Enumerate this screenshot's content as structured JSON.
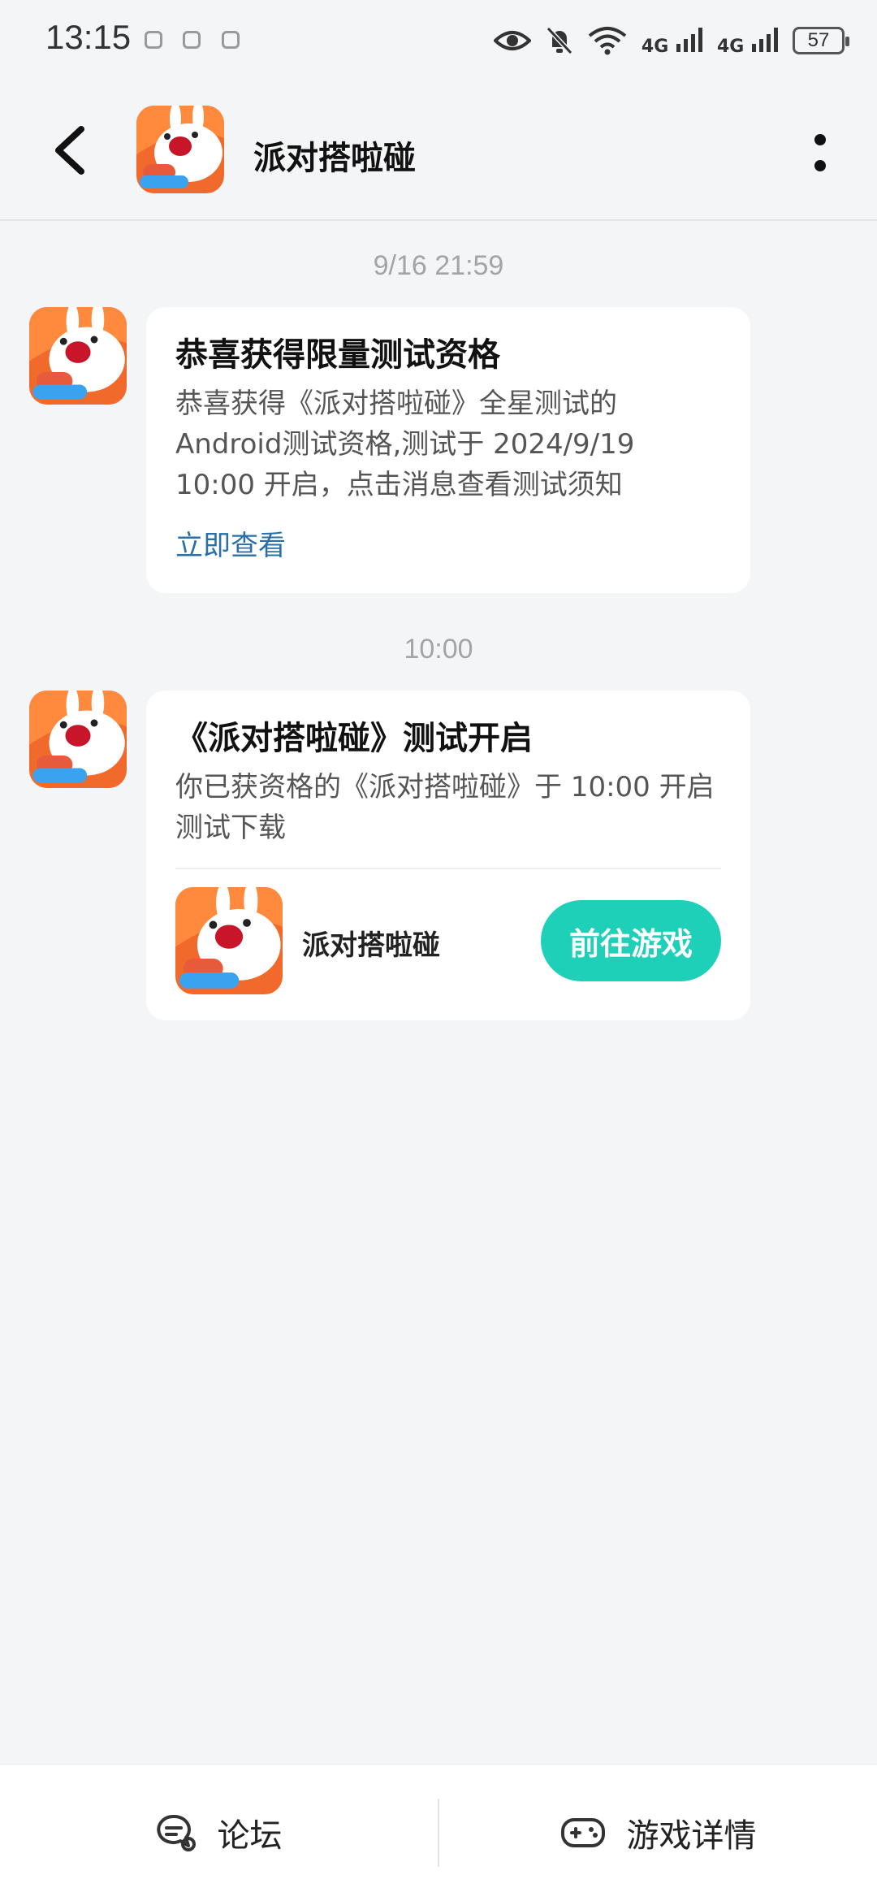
{
  "status_bar": {
    "time": "13:15",
    "network_1": "4G",
    "network_2": "4G",
    "battery": "57",
    "icons": [
      "wechat-notification-icon",
      "wechat-notification-icon",
      "wechat-notification-icon",
      "eye-icon",
      "mute-bell-icon",
      "wifi-icon",
      "signal-icon",
      "signal-icon",
      "battery-icon"
    ]
  },
  "header": {
    "title": "派对搭啦碰",
    "back_icon": "chevron-left-icon",
    "more_icon": "vertical-dots-icon"
  },
  "messages": [
    {
      "timestamp": "9/16  21:59",
      "title": "恭喜获得限量测试资格",
      "body": "恭喜获得《派对搭啦碰》全星测试的Android测试资格,测试于 2024/9/19 10:00 开启，点击消息查看测试须知",
      "link": "立即查看"
    },
    {
      "timestamp": "10:00",
      "title": "《派对搭啦碰》测试开启",
      "body": "你已获资格的《派对搭啦碰》于 10:00 开启测试下载",
      "game_name": "派对搭啦碰",
      "button": "前往游戏"
    }
  ],
  "bottom_nav": {
    "forum": "论坛",
    "game_details": "游戏详情"
  },
  "colors": {
    "accent": "#1fd0b8",
    "link": "#2a6fa8",
    "background": "#f4f5f7"
  }
}
